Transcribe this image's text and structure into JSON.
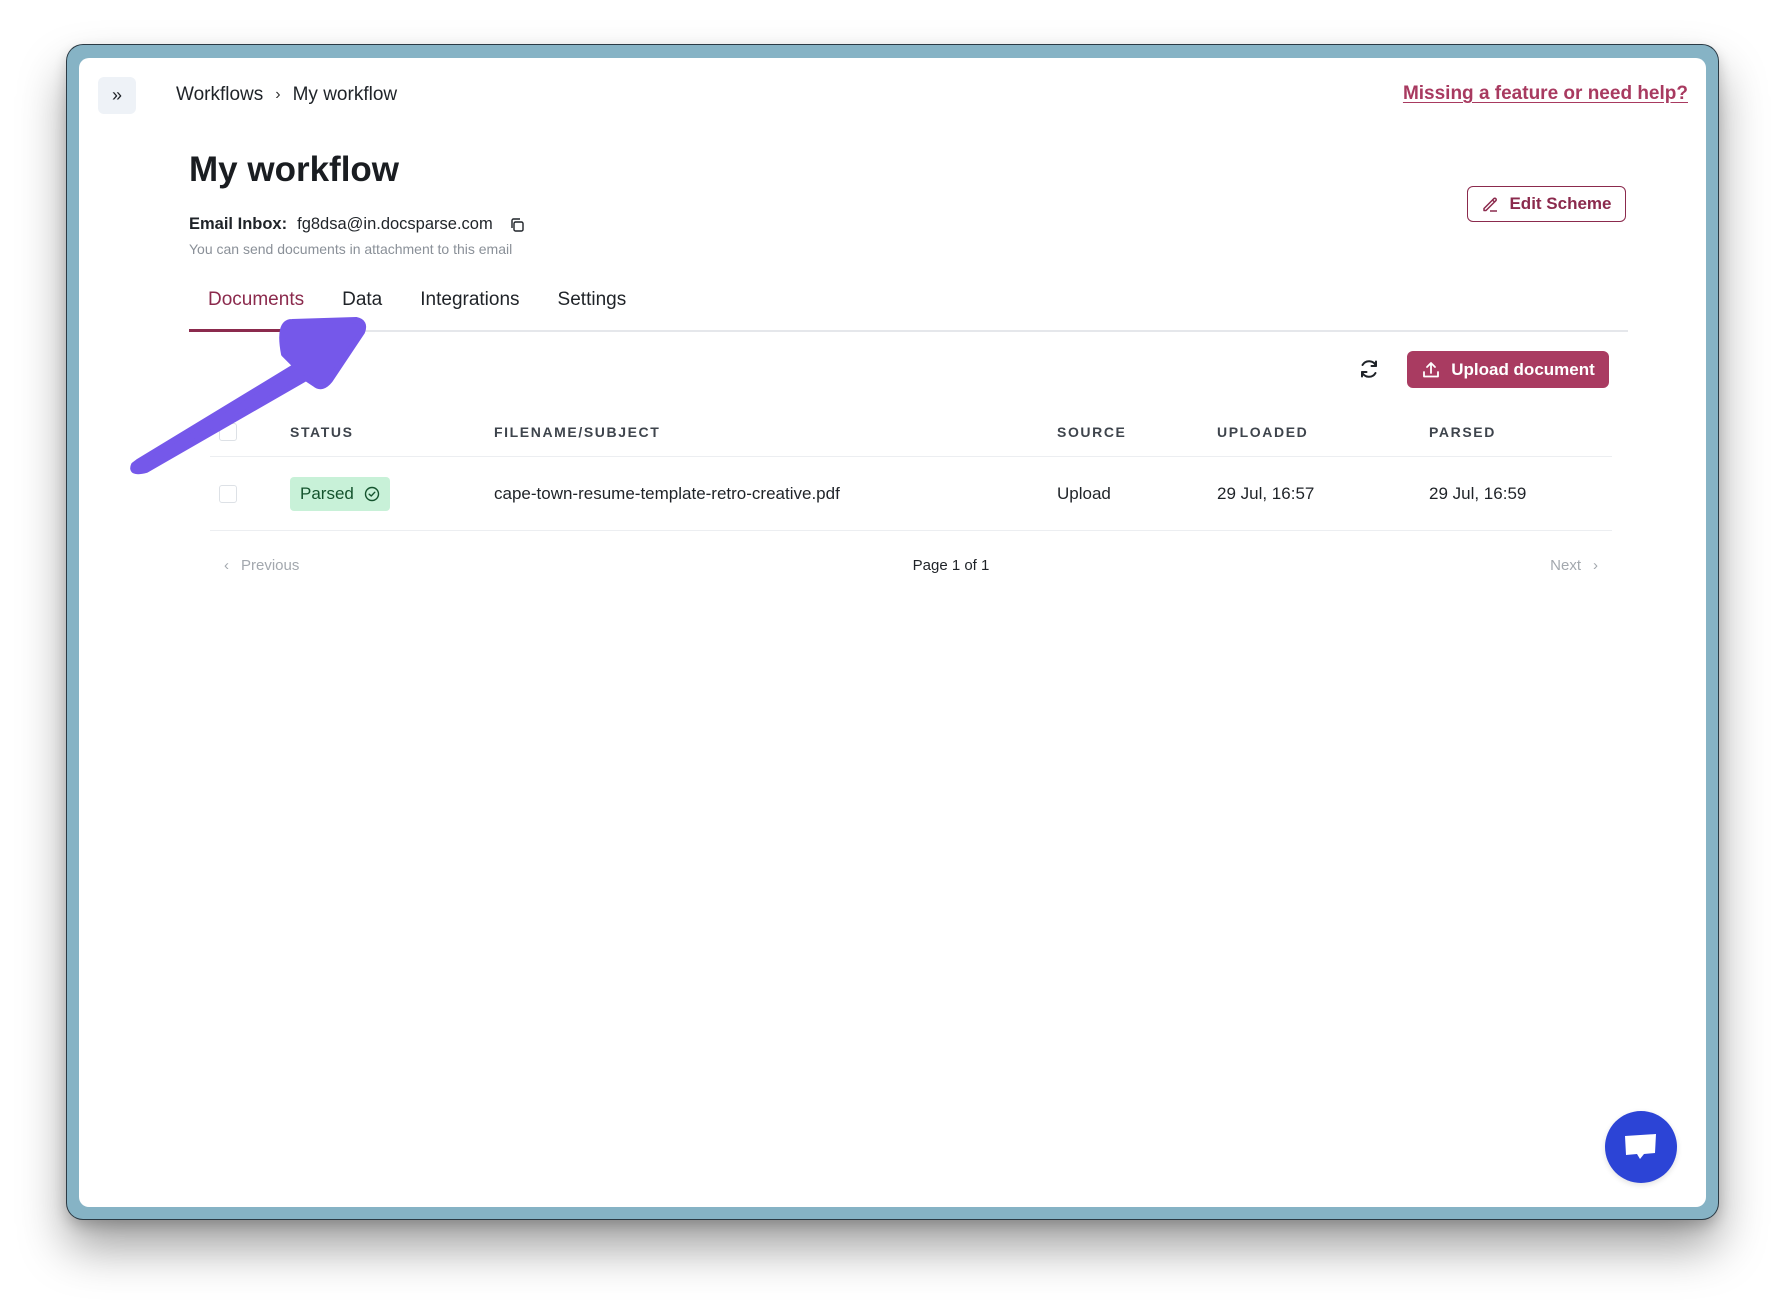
{
  "header": {
    "sidebar_toggle_icon": "double-chevron-right-icon",
    "sidebar_toggle_glyph": "»",
    "breadcrumb": [
      "Workflows",
      "My workflow"
    ],
    "breadcrumb_separator": "›",
    "help_link": "Missing a feature or need help?"
  },
  "workflow": {
    "title": "My workflow",
    "email_label": "Email Inbox:",
    "email_value": "fg8dsa@in.docsparse.com",
    "email_hint": "You can send documents in attachment to this email",
    "edit_scheme_label": "Edit Scheme"
  },
  "tabs": [
    {
      "label": "Documents",
      "active": true
    },
    {
      "label": "Data",
      "active": false
    },
    {
      "label": "Integrations",
      "active": false
    },
    {
      "label": "Settings",
      "active": false
    }
  ],
  "toolbar": {
    "upload_label": "Upload document"
  },
  "table": {
    "columns": [
      "STATUS",
      "FILENAME/SUBJECT",
      "SOURCE",
      "UPLOADED",
      "PARSED"
    ],
    "rows": [
      {
        "status": "Parsed",
        "filename": "cape-town-resume-template-retro-creative.pdf",
        "source": "Upload",
        "uploaded": "29 Jul, 16:57",
        "parsed": "29 Jul, 16:59"
      }
    ]
  },
  "pagination": {
    "previous": "Previous",
    "page_info": "Page 1 of 1",
    "next": "Next"
  },
  "colors": {
    "accent": "#8b2a4d",
    "upload_button": "#a93b61",
    "status_parsed_bg": "#c8f1d8",
    "chat_button": "#2c44d6",
    "annotation_arrow": "#7558ea",
    "frame": "#86b3c5"
  }
}
